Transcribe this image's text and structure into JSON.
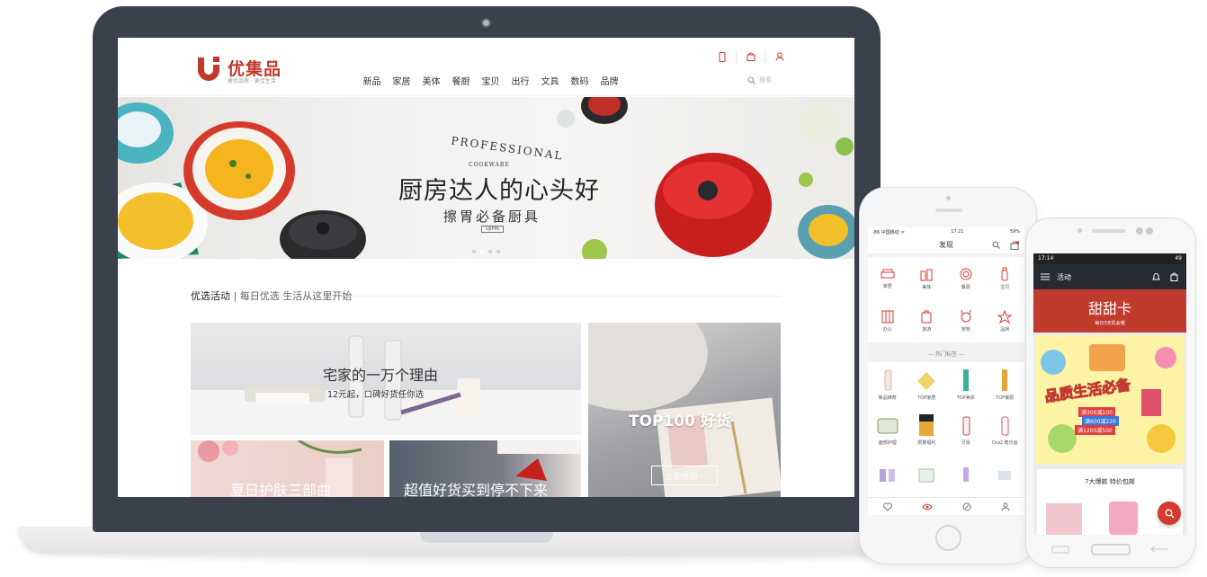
{
  "laptop": {
    "header": {
      "logo_text": "优集品",
      "logo_tagline": "更优品质 · 更佳生活",
      "nav": [
        "新品",
        "家居",
        "美体",
        "餐厨",
        "宝贝",
        "出行",
        "文具",
        "数码",
        "品牌"
      ],
      "search_placeholder": "搜索",
      "icons": [
        "mobile-icon",
        "bag-icon",
        "user-icon"
      ]
    },
    "banner": {
      "brand_arc": "PROFESSIONAL",
      "brand_sub": "COOKWARE",
      "headline": "厨房达人的心头好",
      "subline": "擦胃必备厨具",
      "tag": "UJIPIN",
      "dots": 4,
      "active_dot": 1
    },
    "section": {
      "title": "优选活动",
      "subtitle": "每日优选 生活从这里开始"
    },
    "cards": [
      {
        "title": "宅家的一万个理由",
        "subtitle": "12元起，口碑好货任你选"
      },
      {
        "title": "TOP100 好货",
        "button": "立即抢购 ›"
      },
      {
        "title": "夏日护肤三部曲"
      },
      {
        "title": "超值好货买到停不下来"
      }
    ]
  },
  "phone1": {
    "status": {
      "carrier": "-86 中国移动 ᯤ",
      "time": "17:21",
      "battery": "59%"
    },
    "title": "发现",
    "categories": [
      "家居",
      "美体",
      "餐厨",
      "宝贝",
      "办公",
      "旅游",
      "宠物",
      "品牌"
    ],
    "hot_title": "— 热门标签 —",
    "products": [
      "新品推荐",
      "TOP家居",
      "TOP美体",
      "TOP餐厨",
      "面部护理",
      "限量福利",
      "牙膏",
      "Ora2 晧乐齿",
      "",
      "",
      "",
      ""
    ]
  },
  "phone2": {
    "status": {
      "time": "17:14",
      "right": "49"
    },
    "title": "活动",
    "banner_title": "甜甜卡",
    "banner_sub": "每日3天机会哦",
    "promo": {
      "headline": "品质生活必备",
      "deals": [
        "满300减100",
        "满600减220",
        "满1200减500"
      ]
    },
    "card_title": "7大爆款 特价包邮"
  },
  "colors": {
    "brand": "#c0392b",
    "accent": "#d43a2e",
    "dark": "#262a33"
  }
}
